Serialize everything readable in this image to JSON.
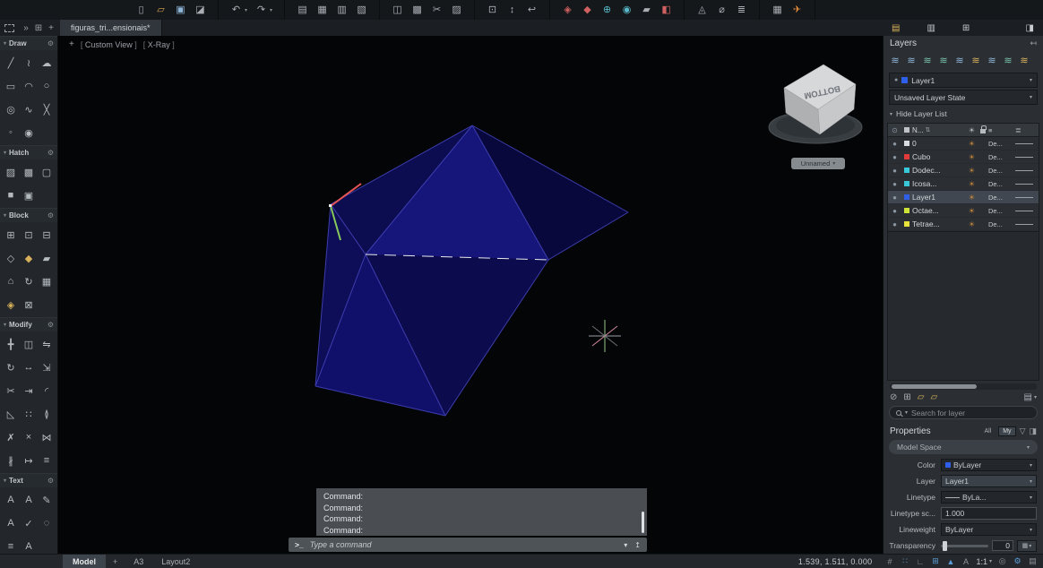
{
  "tab_bar": {
    "document_tab": "figuras_tri...ensionais*"
  },
  "viewport": {
    "menu_control": "+",
    "view_control": "Custom View",
    "style_control": "X-Ray",
    "viewcube_face": "BOTTOM",
    "view_dropdown": "Unnamed"
  },
  "sidebar": {
    "sections": [
      {
        "label": "Draw"
      },
      {
        "label": "Hatch"
      },
      {
        "label": "Block"
      },
      {
        "label": "Modify"
      },
      {
        "label": "Text"
      }
    ]
  },
  "layers": {
    "title": "Layers",
    "current_layer": "Layer1",
    "layer_state": "Unsaved Layer State",
    "hide_list": "Hide Layer List",
    "name_column": "N...",
    "rows": [
      {
        "name": "0",
        "color": "#d8dcdf",
        "lineweight": "De..."
      },
      {
        "name": "Cubo",
        "color": "#e03a3a",
        "lineweight": "De..."
      },
      {
        "name": "Dodec...",
        "color": "#38c8d8",
        "lineweight": "De..."
      },
      {
        "name": "Icosa...",
        "color": "#38c8d8",
        "lineweight": "De..."
      },
      {
        "name": "Layer1",
        "color": "#2f5fe8",
        "lineweight": "De..."
      },
      {
        "name": "Octae...",
        "color": "#cfe23a",
        "lineweight": "De..."
      },
      {
        "name": "Tetrae...",
        "color": "#e8e23a",
        "lineweight": "De..."
      }
    ],
    "search_placeholder": "Search for layer"
  },
  "properties": {
    "title": "Properties",
    "filter_all": "All",
    "filter_my": "My",
    "space": "Model Space",
    "color_label": "Color",
    "color_value": "ByLayer",
    "color_swatch": "#2f5fe8",
    "layer_label": "Layer",
    "layer_value": "Layer1",
    "linetype_label": "Linetype",
    "linetype_value": "ByLa...",
    "linetype_scale_label": "Linetype sc...",
    "linetype_scale_value": "1.000",
    "lineweight_label": "Lineweight",
    "lineweight_value": "ByLayer",
    "transparency_label": "Transparency",
    "transparency_value": "0"
  },
  "command": {
    "history": [
      "Command:",
      "Command:",
      "Command:",
      "Command:"
    ],
    "prompt": ">_",
    "placeholder": "Type a command"
  },
  "status": {
    "model": "Model",
    "plus": "+",
    "layout1": "A3",
    "layout2": "Layout2",
    "coordinates": "1.539, 1.511, 0.000",
    "annotation_scale": "1:1"
  },
  "colors": {
    "accent_blue": "#5b9bd5",
    "shape_blue": "#15157a",
    "viewport_bg": "#040507"
  },
  "icons": {
    "chev": "▾",
    "chevrons": "»",
    "plus": "+",
    "tab-grid": "⊞",
    "qat-new": "▯",
    "qat-open": "▱",
    "qat-save": "▣",
    "qat-saveas": "◪",
    "qat-undo": "↶",
    "qat-redo": "↷",
    "qat-print": "▤",
    "qat-plot": "▦",
    "qat-publish": "▥",
    "qat-batch": "▧",
    "qat-copy": "◫",
    "qat-paste": "▩",
    "qat-cut": "✂",
    "qat-match": "▨",
    "qat-zoom": "⊡",
    "qat-pan": "↕",
    "qat-back": "↩",
    "qat-xref": "◈",
    "qat-palette": "◆",
    "qat-web": "⊕",
    "qat-etransmit": "◉",
    "qat-markup": "▰",
    "qat-pdf": "◧",
    "qat-render": "◬",
    "qat-measure": "⌀",
    "qat-sheetset": "≣",
    "qat-grid2": "▦",
    "qat-send": "✈",
    "panel-t1": "▤",
    "panel-t2": "▥",
    "panel-t3": "⊞",
    "panel-dock": "◨",
    "panel-hide": "↤",
    "lt": "≋",
    "eye": "⊙",
    "sort": "⇅",
    "sun": "☀",
    "lines": "≡",
    "lines2": "≣",
    "dot": "●",
    "lb-clip": "⊘",
    "lb-state": "⊞",
    "lb-folder": "▱",
    "lb-menu": "▤",
    "share": "↥",
    "gear": "⚙",
    "funnel": "▽",
    "pin": "◨",
    "t-line": "╱",
    "t-pline": "≀",
    "t-revcloud": "☁",
    "t-rect": "▭",
    "t-arc": "◠",
    "t-circle": "○",
    "t-ellipse": "◎",
    "t-spline": "∿",
    "t-xline": "╳",
    "t-point": "◦",
    "t-donut": "◉",
    "t-hatch": "▨",
    "t-gradient": "▩",
    "t-boundary": "▢",
    "t-solid": "■",
    "t-hatchedit": "▣",
    "t-insert": "⊞",
    "t-cblock": "⊡",
    "t-wblock": "⊟",
    "t-attdef": "◇",
    "t-attedit": "◆",
    "t-bedit": "▰",
    "t-base": "⌂",
    "t-attsync": "↻",
    "t-battman": "▦",
    "t-xattach": "◈",
    "t-count": "⊠",
    "t-move": "╋",
    "t-copy": "◫",
    "t-rotate": "↻",
    "t-mirror": "⇋",
    "t-stretch": "↔",
    "t-scale": "⇲",
    "t-trim": "✂",
    "t-extend": "⇥",
    "t-fillet": "◜",
    "t-chamfer": "◺",
    "t-array": "∷",
    "t-offset": "≬",
    "t-erase": "✗",
    "t-explode": "×",
    "t-join": "⋈",
    "t-break": "∦",
    "t-length": "↦",
    "t-align": "≡",
    "t-mtext": "A",
    "t-text": "A",
    "t-tedit": "✎",
    "t-tstyle": "A",
    "t-spell": "✓",
    "t-find": "◌",
    "t-justify": "≡",
    "t-tscale": "A",
    "s-grid": "#",
    "s-snap": "∷",
    "s-ortho": "∟",
    "s-osnap": "⊞",
    "s-annovis": "▲",
    "s-autoscale": "A",
    "s-isolate": "◎",
    "s-custom": "▤",
    "s-transp": "▦"
  }
}
